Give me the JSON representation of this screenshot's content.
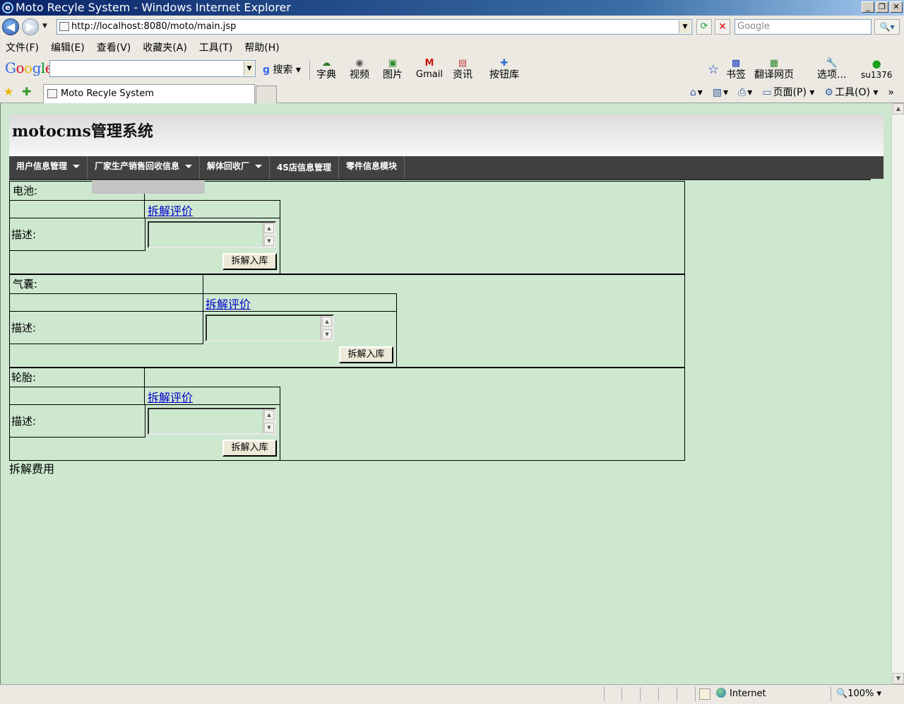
{
  "window": {
    "title": "Moto Recyle System - Windows Internet Explorer"
  },
  "address": {
    "url": "http://localhost:8080/moto/main.jsp",
    "search_placeholder": "Google"
  },
  "menu": [
    "文件(F)",
    "编辑(E)",
    "查看(V)",
    "收藏夹(A)",
    "工具(T)",
    "帮助(H)"
  ],
  "google_toolbar": {
    "search_label": "搜索",
    "buttons": [
      "字典",
      "视频",
      "图片",
      "Gmail",
      "资讯",
      "按钮库"
    ],
    "right_buttons": [
      "书签",
      "翻译网页",
      "选项...",
      "su1376"
    ]
  },
  "tab": {
    "title": "Moto Recyle System"
  },
  "command_bar": {
    "page": "页面(P)",
    "tools": "工具(O)"
  },
  "app": {
    "title": "motocms管理系统",
    "nav": [
      {
        "label": "用户信息管理",
        "dropdown": true
      },
      {
        "label": "厂家生产销售回收信息",
        "dropdown": true
      },
      {
        "label": "解体回收厂",
        "dropdown": true
      },
      {
        "label": "4S店信息管理",
        "dropdown": false
      },
      {
        "label": "零件信息模块",
        "dropdown": false
      }
    ],
    "parts": [
      {
        "name": "电池:",
        "eval_link": "拆解评价",
        "desc_label": "描述:",
        "desc_value": "",
        "submit": "拆解入库"
      },
      {
        "name": "气囊:",
        "eval_link": "拆解评价",
        "desc_label": "描述:",
        "desc_value": "",
        "submit": "拆解入库"
      },
      {
        "name": "轮胎:",
        "eval_link": "拆解评价",
        "desc_label": "描述:",
        "desc_value": "",
        "submit": "拆解入库"
      }
    ],
    "footer": "拆解费用"
  },
  "status": {
    "zone": "Internet",
    "zoom": "100%"
  }
}
